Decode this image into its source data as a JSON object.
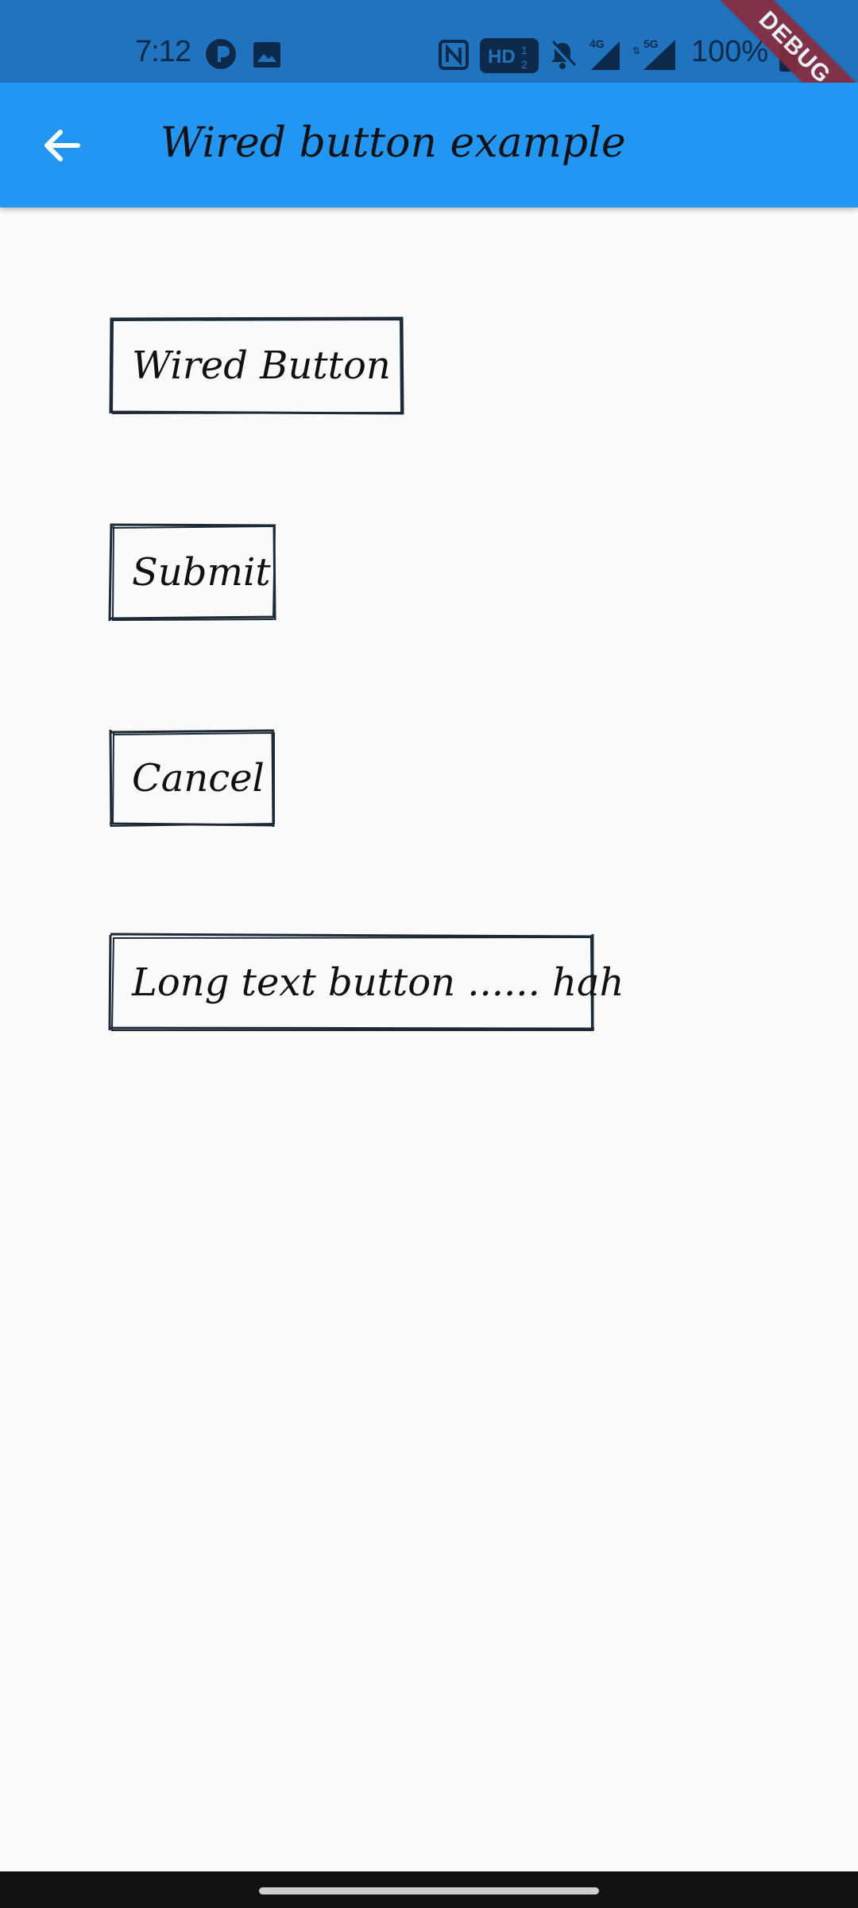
{
  "status_bar": {
    "time": "7:12",
    "battery": "100%",
    "network_labels": [
      "4G",
      "5G"
    ],
    "hd_badge": "HD",
    "icons": [
      "notification-app-icon",
      "image-icon",
      "nfc-icon",
      "hd-icon",
      "bell-off-icon",
      "signal-4g-icon",
      "signal-5g-icon",
      "battery-icon"
    ]
  },
  "debug_banner": "DEBUG",
  "app_bar": {
    "title": "Wired button example",
    "back_icon": "arrow-back-icon",
    "background": "#2196f3"
  },
  "buttons": [
    {
      "label": "Wired Button"
    },
    {
      "label": "Submit"
    },
    {
      "label": "Cancel"
    },
    {
      "label": "Long text button ...... hah"
    }
  ],
  "colors": {
    "status_bar": "#1f74bd",
    "app_bar": "#2196f3",
    "background": "#fafafa",
    "wire_stroke": "#1c2a38",
    "debug_banner": "#8b2c3c"
  }
}
